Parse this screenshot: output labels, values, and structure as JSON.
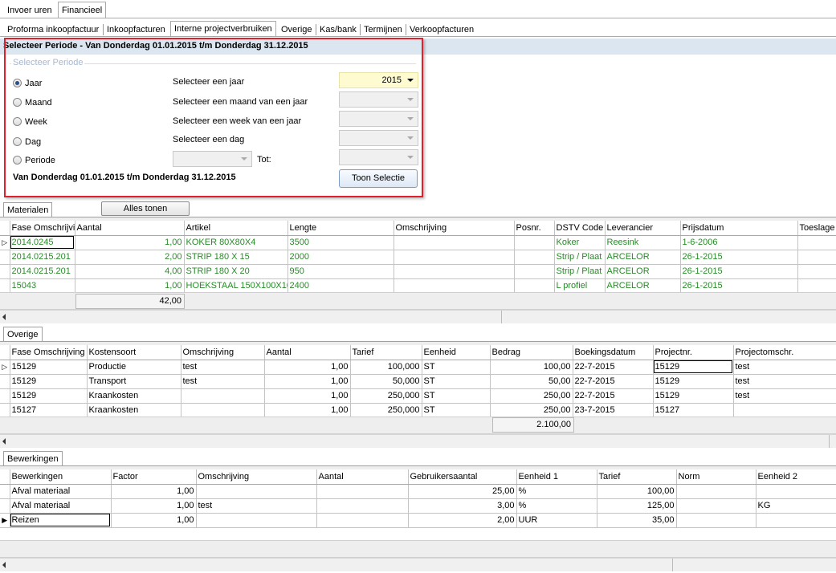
{
  "top_tabs": [
    "Invoer uren",
    "Financieel"
  ],
  "sub_tabs": [
    "Proforma inkoopfactuur",
    "Inkoopfacturen",
    "Interne projectverbruiken",
    "Overige",
    "Kas/bank",
    "Termijnen",
    "Verkoopfacturen"
  ],
  "period": {
    "header": "Selecteer Periode - Van Donderdag 01.01.2015 t/m Donderdag 31.12.2015",
    "group_label": "Selecteer Periode",
    "options": [
      "Jaar",
      "Maand",
      "Week",
      "Dag",
      "Periode"
    ],
    "selected": "Jaar",
    "select_year": "Selecteer een jaar",
    "select_month": "Selecteer een maand van een jaar",
    "select_week": "Selecteer een week van een jaar",
    "select_day": "Selecteer een dag",
    "to_label": "Tot:",
    "year_value": "2015",
    "summary": "Van Donderdag 01.01.2015 t/m Donderdag 31.12.2015",
    "show_button": "Toon Selectie"
  },
  "materialen": {
    "tab": "Materialen",
    "show_all": "Alles tonen",
    "columns": [
      "Fase Omschrijvi",
      "Aantal",
      "Artikel",
      "Lengte",
      "Omschrijving",
      "Posnr.",
      "DSTV Code",
      "Leverancier",
      "Prijsdatum",
      "Toeslage"
    ],
    "rows": [
      [
        "2014.0245",
        "1,00",
        "KOKER 80X80X4",
        "3500",
        "",
        "",
        "Koker",
        "Reesink",
        "1-6-2006",
        ""
      ],
      [
        "2014.0215.201",
        "2,00",
        "STRIP 180 X 15",
        "2000",
        "",
        "",
        "Strip / Plaat",
        "ARCELOR",
        "26-1-2015",
        ""
      ],
      [
        "2014.0215.201",
        "4,00",
        "STRIP 180 X 20",
        "950",
        "",
        "",
        "Strip / Plaat",
        "ARCELOR",
        "26-1-2015",
        ""
      ],
      [
        "15043",
        "1,00",
        "HOEKSTAAL 150X100X10",
        "2400",
        "",
        "",
        "L profiel",
        "ARCELOR",
        "26-1-2015",
        ""
      ]
    ],
    "total": "42,00"
  },
  "overige": {
    "tab": "Overige",
    "columns": [
      "Fase Omschrijving",
      "Kostensoort",
      "Omschrijving",
      "Aantal",
      "Tarief",
      "Eenheid",
      "Bedrag",
      "Boekingsdatum",
      "Projectnr.",
      "Projectomschr."
    ],
    "rows": [
      [
        "15129",
        "Productie",
        "test",
        "1,00",
        "100,000",
        "ST",
        "100,00",
        "22-7-2015",
        "15129",
        "test"
      ],
      [
        "15129",
        "Transport",
        "test",
        "1,00",
        "50,000",
        "ST",
        "50,00",
        "22-7-2015",
        "15129",
        "test"
      ],
      [
        "15129",
        "Kraankosten",
        "",
        "1,00",
        "250,000",
        "ST",
        "250,00",
        "22-7-2015",
        "15129",
        "test"
      ],
      [
        "15127",
        "Kraankosten",
        "",
        "1,00",
        "250,000",
        "ST",
        "250,00",
        "23-7-2015",
        "15127",
        ""
      ]
    ],
    "total": "2.100,00"
  },
  "bewerkingen": {
    "tab": "Bewerkingen",
    "columns": [
      "Bewerkingen",
      "Factor",
      "Omschrijving",
      "Aantal",
      "Gebruikersaantal",
      "Eenheid 1",
      "Tarief",
      "Norm",
      "Eenheid 2"
    ],
    "rows": [
      [
        "Afval materiaal",
        "1,00",
        "",
        "",
        "25,00",
        "%",
        "100,00",
        "",
        ""
      ],
      [
        "Afval materiaal",
        "1,00",
        "test",
        "",
        "3,00",
        "%",
        "125,00",
        "",
        "KG"
      ],
      [
        "Reizen",
        "1,00",
        "",
        "",
        "2,00",
        "UUR",
        "35,00",
        "",
        ""
      ]
    ]
  }
}
